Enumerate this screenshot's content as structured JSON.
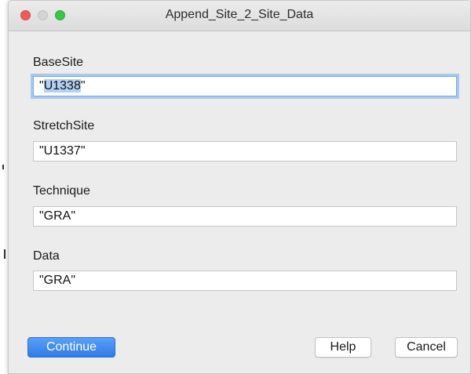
{
  "window": {
    "title": "Append_Site_2_Site_Data"
  },
  "fields": [
    {
      "label": "BaseSite",
      "value_quote_open": "\"",
      "value_selected": "U1338",
      "value_quote_close": "\""
    },
    {
      "label": "StretchSite",
      "value": "\"U1337\""
    },
    {
      "label": "Technique",
      "value": "\"GRA\""
    },
    {
      "label": "Data",
      "value": "\"GRA\""
    }
  ],
  "buttons": {
    "continue": "Continue",
    "help": "Help",
    "cancel": "Cancel"
  },
  "colors": {
    "primary_button": "#2f7be8",
    "focus_ring": "#a9c8f0",
    "selection": "#b3d1f5",
    "close": "#ee5b5b",
    "zoom": "#3cc34a"
  },
  "icons": [
    "close-icon",
    "minimize-icon",
    "zoom-icon"
  ]
}
